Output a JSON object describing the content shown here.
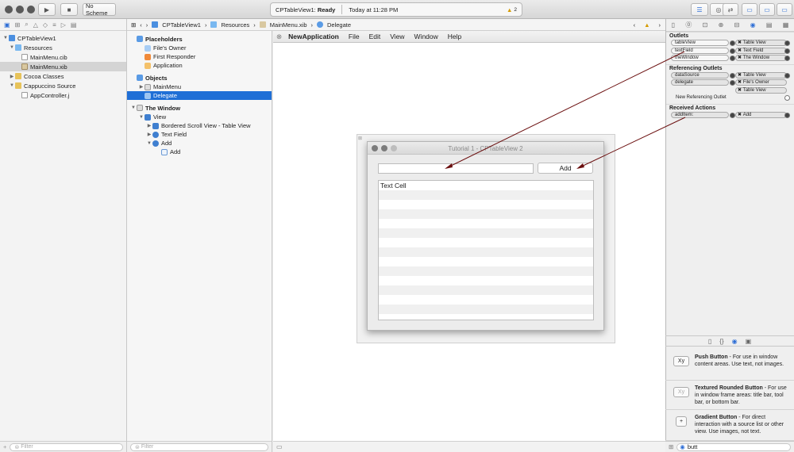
{
  "toolbar": {
    "scheme": "No Scheme",
    "status_project": "CPTableView1",
    "status_state": "Ready",
    "status_time": "Today at 11:28 PM",
    "warning_count": "2"
  },
  "navigator": {
    "items": [
      {
        "label": "CPTableView1",
        "level": 0,
        "icon": "project-icon",
        "open": true
      },
      {
        "label": "Resources",
        "level": 1,
        "icon": "folder-icon",
        "open": true
      },
      {
        "label": "MainMenu.cib",
        "level": 2,
        "icon": "file-icon"
      },
      {
        "label": "MainMenu.xib",
        "level": 2,
        "icon": "xib-file-icon",
        "selected": true
      },
      {
        "label": "Cocoa Classes",
        "level": 1,
        "icon": "folder-icon",
        "open": false
      },
      {
        "label": "Cappuccino Source",
        "level": 1,
        "icon": "folder-icon",
        "open": true
      },
      {
        "label": "AppController.j",
        "level": 2,
        "icon": "file-icon"
      }
    ],
    "filter_placeholder": "Filter"
  },
  "jumpbar": {
    "crumbs": [
      "CPTableView1",
      "Resources",
      "MainMenu.xib",
      "Delegate"
    ]
  },
  "outline": {
    "placeholders_title": "Placeholders",
    "placeholders": [
      "File's Owner",
      "First Responder",
      "Application"
    ],
    "objects_title": "Objects",
    "objects": [
      "MainMenu",
      "Delegate"
    ],
    "window_title": "The Window",
    "view_label": "View",
    "view_children": [
      "Bordered Scroll View - Table View",
      "Text Field",
      "Add"
    ],
    "add_child": "Add",
    "filter_placeholder": "Filter"
  },
  "canvas": {
    "menu": [
      "NewApplication",
      "File",
      "Edit",
      "View",
      "Window",
      "Help"
    ],
    "window_title": "Tutorial 1 - CPTableView 2",
    "add_button": "Add",
    "table_first_cell": "Text Cell"
  },
  "inspector": {
    "outlets_title": "Outlets",
    "outlets": [
      {
        "name": "tableView",
        "target": "Table View"
      },
      {
        "name": "textField",
        "target": "Text Field"
      },
      {
        "name": "theWindow",
        "target": "The Window"
      }
    ],
    "ref_title": "Referencing Outlets",
    "ref_outlets": [
      {
        "name": "dataSource",
        "target": "Table View"
      },
      {
        "name": "delegate",
        "target": "File's Owner"
      },
      {
        "name": "",
        "target": "Table View"
      }
    ],
    "new_ref": "New Referencing Outlet",
    "actions_title": "Received Actions",
    "actions": [
      {
        "name": "addItem:",
        "target": "Add"
      }
    ],
    "remove_glyph": "✖"
  },
  "library": {
    "items": [
      {
        "icon_text": "Xy",
        "title": "Push Button",
        "desc": " - For use in window content areas. Use text, not images."
      },
      {
        "icon_text": "Xy",
        "title": "Textured Rounded Button",
        "desc": " - For use in window frame areas: title bar, tool bar, or bottom bar."
      },
      {
        "icon_text": "+",
        "title": "Gradient Button",
        "desc": " - For direct interaction with a source list or other view. Use images, not text."
      }
    ],
    "search_value": "butt"
  },
  "colors": {
    "selection": "#1f6fd6",
    "connection_line": "#6b0f0f"
  }
}
